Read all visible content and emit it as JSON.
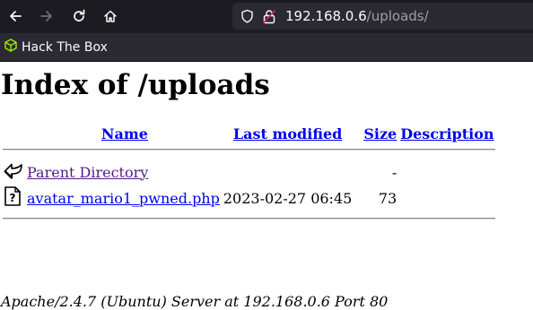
{
  "browser": {
    "url_host": "192.168.0.6",
    "url_path": "/uploads/",
    "bookmark_label": "Hack The Box"
  },
  "page": {
    "title": "Index of /uploads",
    "columns": {
      "name": "Name",
      "last_modified": "Last modified",
      "size": "Size",
      "description": "Description"
    },
    "rows": [
      {
        "icon": "back-icon",
        "name": "Parent Directory",
        "modified": "",
        "size": "-",
        "description": ""
      },
      {
        "icon": "unknown-file-icon",
        "name": "avatar_mario1_pwned.php",
        "modified": "2023-02-27 06:45",
        "size": "73",
        "description": ""
      }
    ],
    "footer": "Apache/2.4.7 (Ubuntu) Server at 192.168.0.6 Port 80"
  },
  "colors": {
    "link": "#0000ee",
    "visited": "#551a8b",
    "chrome": "#1c1b22",
    "urlbar": "#2b2a33"
  }
}
